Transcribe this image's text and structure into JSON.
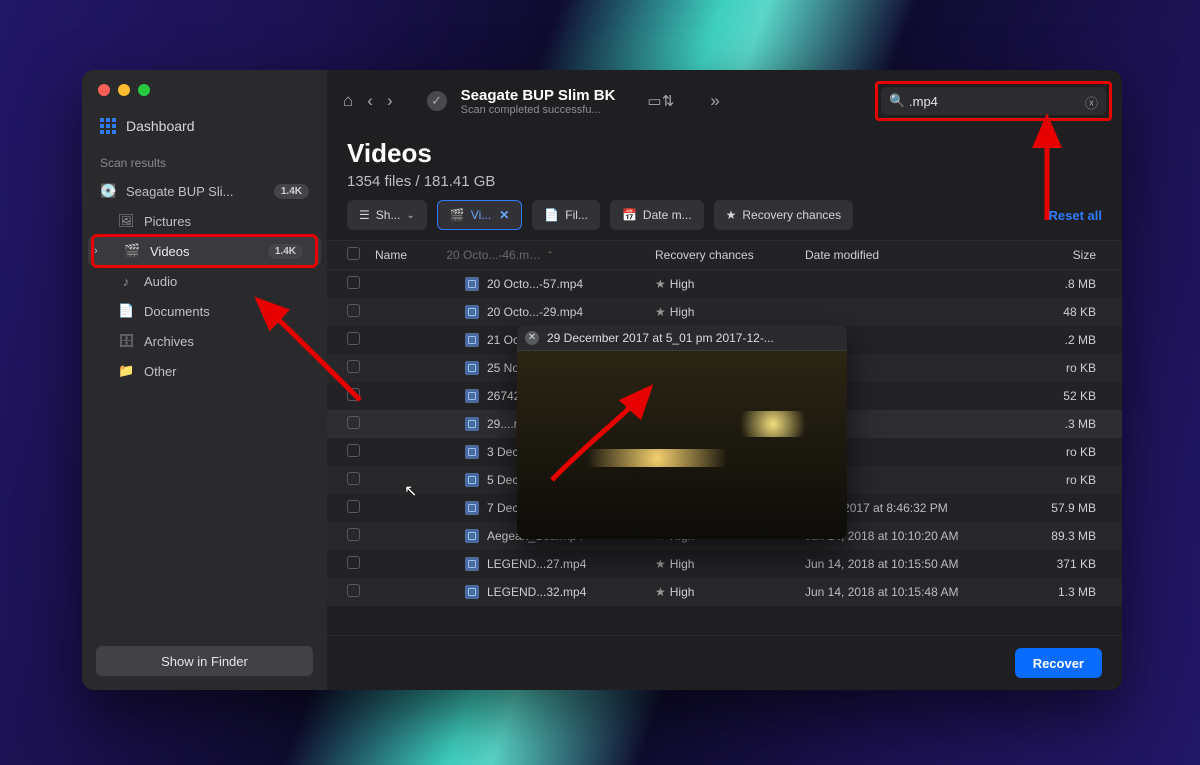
{
  "disk": {
    "title": "Seagate BUP Slim BK",
    "status": "Scan completed successfu..."
  },
  "search": {
    "value": ".mp4"
  },
  "sidebar": {
    "dashboard": "Dashboard",
    "section_label": "Scan results",
    "items": [
      {
        "icon": "💽",
        "label": "Seagate BUP Sli...",
        "badge": "1.4K"
      },
      {
        "icon": "🖼",
        "label": "Pictures"
      },
      {
        "icon": "🎬",
        "label": "Videos",
        "badge": "1.4K",
        "active": true,
        "chev": true
      },
      {
        "icon": "♪",
        "label": "Audio"
      },
      {
        "icon": "📄",
        "label": "Documents"
      },
      {
        "icon": "🗄",
        "label": "Archives"
      },
      {
        "icon": "📁",
        "label": "Other"
      }
    ],
    "finder_btn": "Show in Finder"
  },
  "heading": {
    "title": "Videos",
    "stats": "1354 files / 181.41 GB"
  },
  "filters": {
    "show": "Sh...",
    "video": "Vi...",
    "fil": "Fil...",
    "date": "Date m...",
    "recovery": "Recovery chances",
    "reset": "Reset all"
  },
  "columns": {
    "name": "Name",
    "rc": "Recovery chances",
    "dm": "Date modified",
    "size": "Size",
    "name_value_header": "20 Octo...-46.m…"
  },
  "rows": [
    {
      "name": "20 Octo...-57.mp4",
      "chance": "High",
      "date": "",
      "size": ".8 MB"
    },
    {
      "name": "20 Octo...-29.mp4",
      "chance": "High",
      "date": "",
      "size": "48 KB"
    },
    {
      "name": "21 Octo...-11.mp4",
      "chance": "High",
      "date": "",
      "size": ".2 MB"
    },
    {
      "name": "25 Nove...23.mp4",
      "chance": "High (en",
      "date": "",
      "size": "ro KB"
    },
    {
      "name": "267423...0.n.mp4",
      "chance": "High",
      "date": "",
      "size": "52 KB"
    },
    {
      "name": "29....mp4",
      "chance": "High",
      "date": "",
      "size": ".3 MB",
      "hover": true
    },
    {
      "name": "3 Dece...-25.mp4",
      "chance": "High (en",
      "date": "",
      "size": "ro KB"
    },
    {
      "name": "5 Dece...1-06.mp4",
      "chance": "High (en",
      "date": "",
      "size": "ro KB"
    },
    {
      "name": "7 Dece...5-18.mp4",
      "chance": "High",
      "date": "Dec 7, 2017 at 8:46:32 PM",
      "size": "57.9 MB"
    },
    {
      "name": "Aegean_Sea.mp4",
      "chance": "High",
      "date": "Jun 14, 2018 at 10:10:20 AM",
      "size": "89.3 MB"
    },
    {
      "name": "LEGEND...27.mp4",
      "chance": "High",
      "date": "Jun 14, 2018 at 10:15:50 AM",
      "size": "371 KB"
    },
    {
      "name": "LEGEND...32.mp4",
      "chance": "High",
      "date": "Jun 14, 2018 at 10:15:48 AM",
      "size": "1.3 MB"
    }
  ],
  "preview_title": "29 December 2017 at 5_01 pm 2017-12-...",
  "recover_btn": "Recover"
}
